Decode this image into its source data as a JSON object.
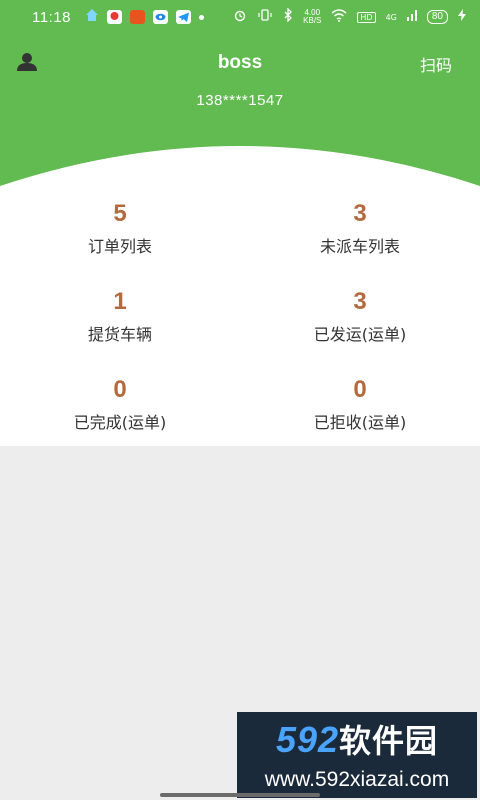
{
  "status_bar": {
    "time": "11:18",
    "network_speed_value": "4.00",
    "network_speed_unit": "KB/S",
    "hd_label": "HD",
    "signal_label": "4G",
    "battery": "80"
  },
  "header": {
    "title": "boss",
    "scan_label": "扫码",
    "phone": "138****1547"
  },
  "stats": [
    {
      "value": "5",
      "label": "订单列表"
    },
    {
      "value": "3",
      "label": "未派车列表"
    },
    {
      "value": "1",
      "label": "提货车辆"
    },
    {
      "value": "3",
      "label": "已发运(运单)"
    },
    {
      "value": "0",
      "label": "已完成(运单)"
    },
    {
      "value": "0",
      "label": "已拒收(运单)"
    }
  ],
  "watermark": {
    "brand_digits": "592",
    "brand_text": "软件园",
    "url": "www.592xiazai.com"
  },
  "colors": {
    "primary_green": "#62bb51",
    "number_color": "#b46a3e",
    "background": "#ededed"
  }
}
